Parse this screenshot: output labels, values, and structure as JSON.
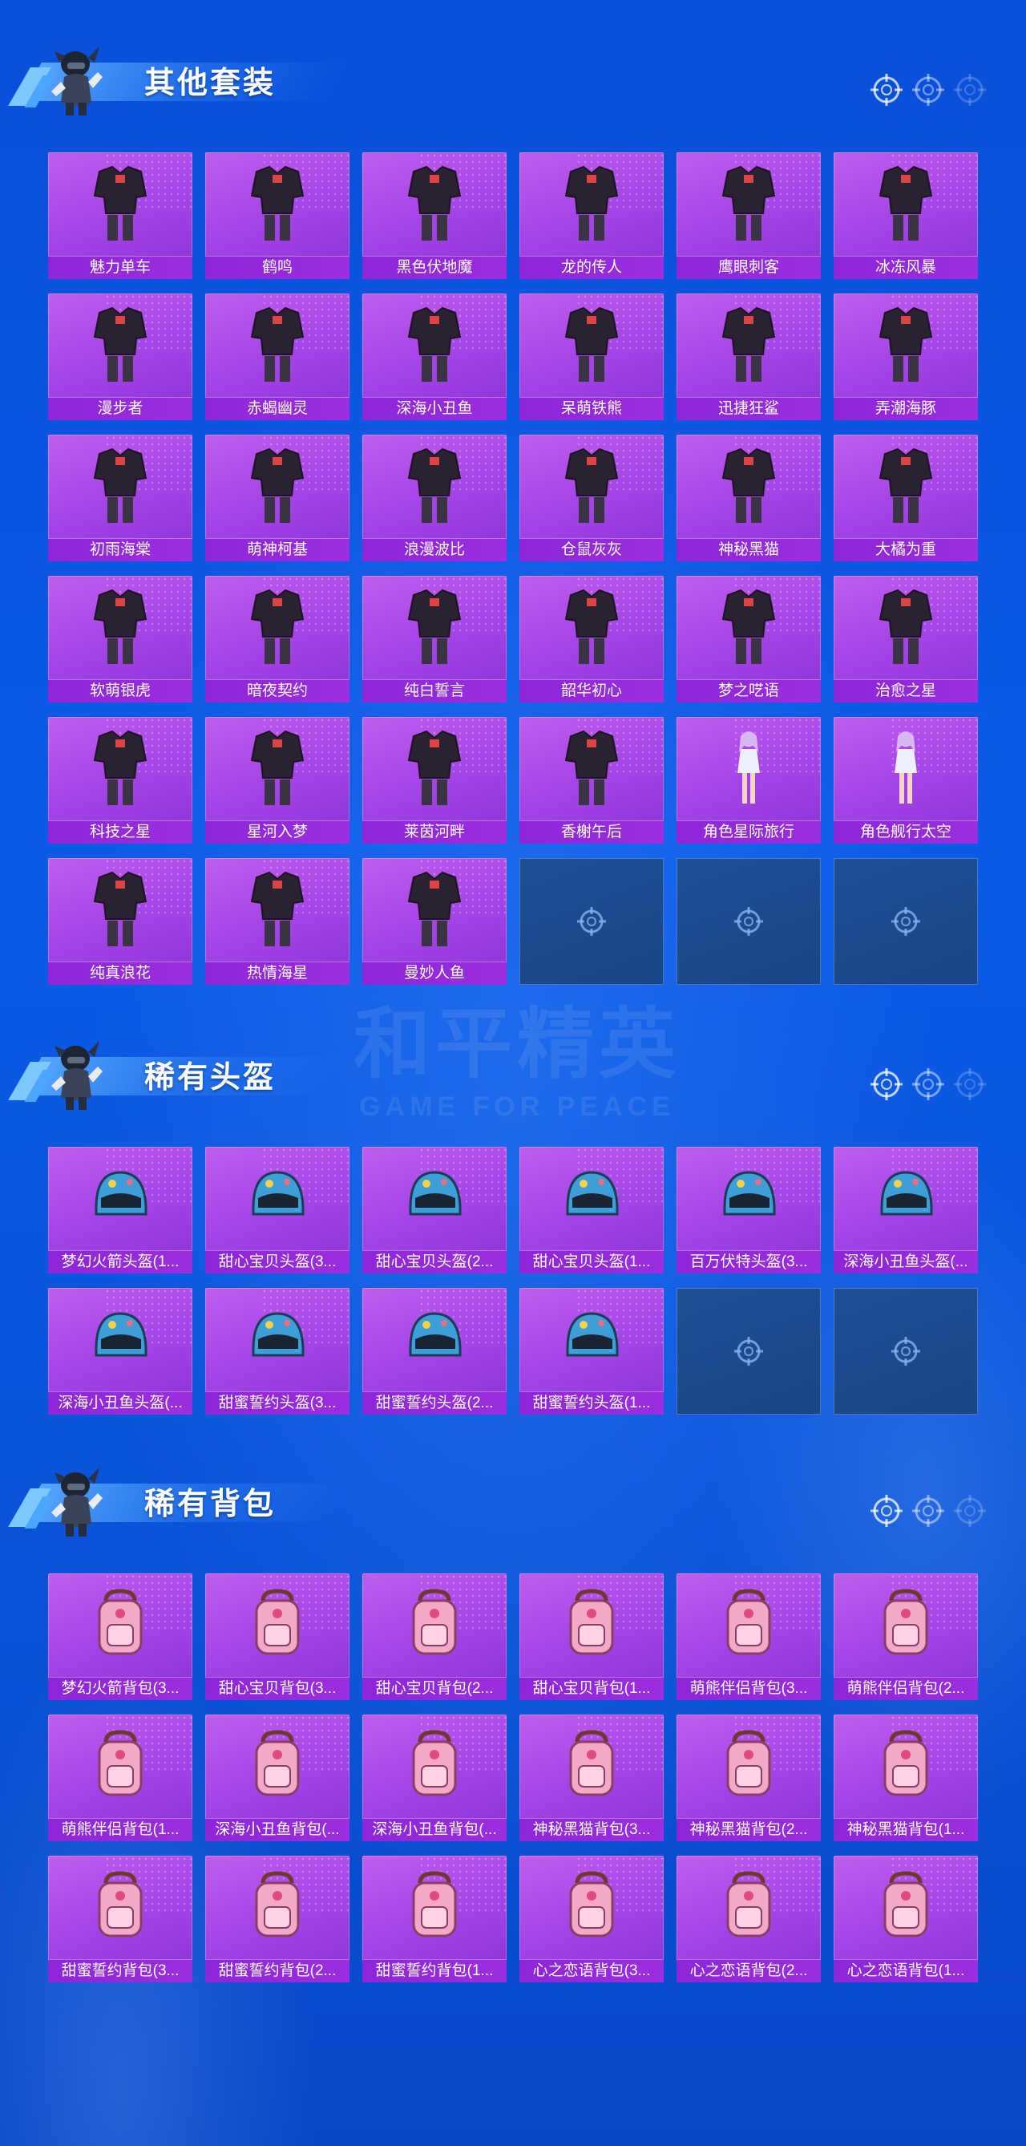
{
  "watermark": {
    "main": "和平精英",
    "sub": "GAME FOR PEACE"
  },
  "colors": {
    "tile": "#a746e8",
    "label_bar": "#8d25d8",
    "empty_slot": "#1f4f95",
    "background": "#0b5be6"
  },
  "sections": [
    {
      "title": "其他套装",
      "empty_slots": 3,
      "items": [
        {
          "label": "魅力单车",
          "icon": "outfit-icon"
        },
        {
          "label": "鹤鸣",
          "icon": "outfit-icon"
        },
        {
          "label": "黑色伏地魔",
          "icon": "outfit-icon"
        },
        {
          "label": "龙的传人",
          "icon": "outfit-icon"
        },
        {
          "label": "鹰眼刺客",
          "icon": "outfit-icon"
        },
        {
          "label": "冰冻风暴",
          "icon": "outfit-icon"
        },
        {
          "label": "漫步者",
          "icon": "outfit-icon"
        },
        {
          "label": "赤蝎幽灵",
          "icon": "outfit-icon"
        },
        {
          "label": "深海小丑鱼",
          "icon": "outfit-icon"
        },
        {
          "label": "呆萌铁熊",
          "icon": "outfit-icon"
        },
        {
          "label": "迅捷狂鲨",
          "icon": "outfit-icon"
        },
        {
          "label": "弄潮海豚",
          "icon": "outfit-icon"
        },
        {
          "label": "初雨海棠",
          "icon": "outfit-icon"
        },
        {
          "label": "萌神柯基",
          "icon": "outfit-icon"
        },
        {
          "label": "浪漫波比",
          "icon": "outfit-icon"
        },
        {
          "label": "仓鼠灰灰",
          "icon": "outfit-icon"
        },
        {
          "label": "神秘黑猫",
          "icon": "outfit-icon"
        },
        {
          "label": "大橘为重",
          "icon": "outfit-icon"
        },
        {
          "label": "软萌银虎",
          "icon": "outfit-icon"
        },
        {
          "label": "暗夜契约",
          "icon": "outfit-icon"
        },
        {
          "label": "纯白誓言",
          "icon": "outfit-icon"
        },
        {
          "label": "韶华初心",
          "icon": "outfit-icon"
        },
        {
          "label": "梦之呓语",
          "icon": "outfit-icon"
        },
        {
          "label": "治愈之星",
          "icon": "outfit-icon"
        },
        {
          "label": "科技之星",
          "icon": "outfit-icon"
        },
        {
          "label": "星河入梦",
          "icon": "outfit-icon"
        },
        {
          "label": "莱茵河畔",
          "icon": "outfit-icon"
        },
        {
          "label": "香榭午后",
          "icon": "outfit-icon"
        },
        {
          "label": "角色星际旅行",
          "icon": "character-icon"
        },
        {
          "label": "角色舰行太空",
          "icon": "character-icon"
        },
        {
          "label": "纯真浪花",
          "icon": "outfit-icon"
        },
        {
          "label": "热情海星",
          "icon": "outfit-icon"
        },
        {
          "label": "曼妙人鱼",
          "icon": "outfit-icon"
        }
      ]
    },
    {
      "title": "稀有头盔",
      "empty_slots": 2,
      "items": [
        {
          "label": "梦幻火箭头盔(1...",
          "icon": "helmet-icon"
        },
        {
          "label": "甜心宝贝头盔(3...",
          "icon": "helmet-icon"
        },
        {
          "label": "甜心宝贝头盔(2...",
          "icon": "helmet-icon"
        },
        {
          "label": "甜心宝贝头盔(1...",
          "icon": "helmet-icon"
        },
        {
          "label": "百万伏特头盔(3...",
          "icon": "helmet-icon"
        },
        {
          "label": "深海小丑鱼头盔(...",
          "icon": "helmet-icon"
        },
        {
          "label": "深海小丑鱼头盔(...",
          "icon": "helmet-icon"
        },
        {
          "label": "甜蜜誓约头盔(3...",
          "icon": "helmet-icon"
        },
        {
          "label": "甜蜜誓约头盔(2...",
          "icon": "helmet-icon"
        },
        {
          "label": "甜蜜誓约头盔(1...",
          "icon": "helmet-icon"
        }
      ]
    },
    {
      "title": "稀有背包",
      "empty_slots": 0,
      "items": [
        {
          "label": "梦幻火箭背包(3...",
          "icon": "backpack-icon"
        },
        {
          "label": "甜心宝贝背包(3...",
          "icon": "backpack-icon"
        },
        {
          "label": "甜心宝贝背包(2...",
          "icon": "backpack-icon"
        },
        {
          "label": "甜心宝贝背包(1...",
          "icon": "backpack-icon"
        },
        {
          "label": "萌熊伴侣背包(3...",
          "icon": "backpack-icon"
        },
        {
          "label": "萌熊伴侣背包(2...",
          "icon": "backpack-icon"
        },
        {
          "label": "萌熊伴侣背包(1...",
          "icon": "backpack-icon"
        },
        {
          "label": "深海小丑鱼背包(...",
          "icon": "backpack-icon"
        },
        {
          "label": "深海小丑鱼背包(...",
          "icon": "backpack-icon"
        },
        {
          "label": "神秘黑猫背包(3...",
          "icon": "backpack-icon"
        },
        {
          "label": "神秘黑猫背包(2...",
          "icon": "backpack-icon"
        },
        {
          "label": "神秘黑猫背包(1...",
          "icon": "backpack-icon"
        },
        {
          "label": "甜蜜誓约背包(3...",
          "icon": "backpack-icon"
        },
        {
          "label": "甜蜜誓约背包(2...",
          "icon": "backpack-icon"
        },
        {
          "label": "甜蜜誓约背包(1...",
          "icon": "backpack-icon"
        },
        {
          "label": "心之恋语背包(3...",
          "icon": "backpack-icon"
        },
        {
          "label": "心之恋语背包(2...",
          "icon": "backpack-icon"
        },
        {
          "label": "心之恋语背包(1...",
          "icon": "backpack-icon"
        }
      ]
    }
  ]
}
